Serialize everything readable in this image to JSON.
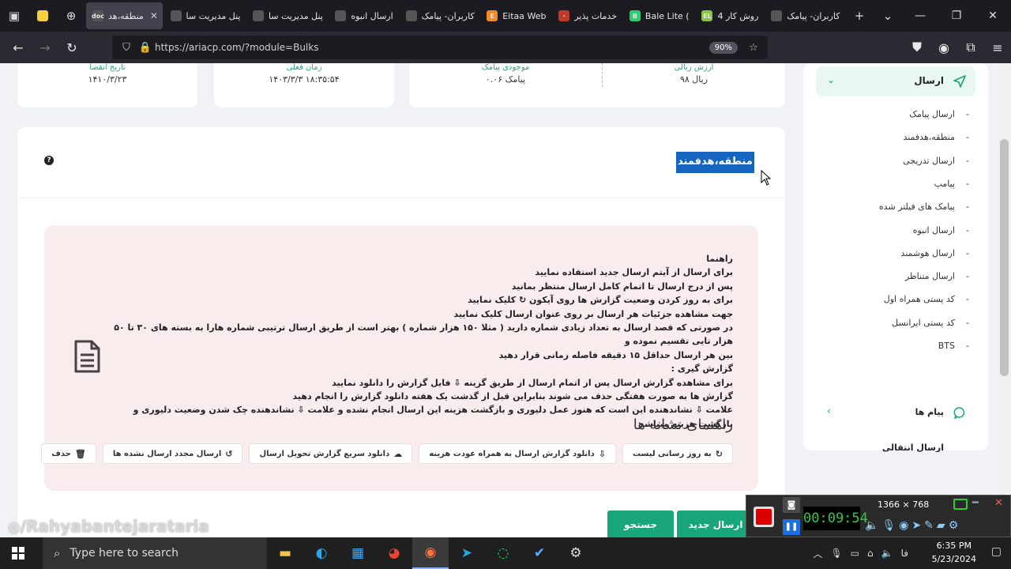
{
  "browser": {
    "tabs": [
      {
        "label": "منطقه،هد",
        "active": true,
        "favicon": "doc",
        "color": "#555"
      },
      {
        "label": "پنل مدیریت سا",
        "active": false,
        "favicon": "",
        "color": "#555"
      },
      {
        "label": "پنل مدیریت سا",
        "active": false,
        "favicon": "",
        "color": "#555"
      },
      {
        "label": "ارسال انبوه",
        "active": false,
        "favicon": "",
        "color": "#555"
      },
      {
        "label": "کاربران- پیامک",
        "active": false,
        "favicon": "",
        "color": "#555"
      },
      {
        "label": "Eitaa Web",
        "active": false,
        "favicon": "E",
        "color": "#f28c28"
      },
      {
        "label": "خدمات پذیر",
        "active": false,
        "favicon": "·",
        "color": "#c0392b"
      },
      {
        "label": "Bale Lite (",
        "active": false,
        "favicon": "B",
        "color": "#2ecc71"
      },
      {
        "label": "4 روش کار",
        "active": false,
        "favicon": "EL",
        "color": "#8bc34a"
      },
      {
        "label": "کاربران- پیامک",
        "active": false,
        "favicon": "",
        "color": "#555"
      }
    ],
    "url": "https://ariacp.com/?module=Bulks",
    "zoom": "90%"
  },
  "stats": [
    {
      "label": "ارزش ریالی",
      "value": "۹۸ ریال"
    },
    {
      "label": "موجودی پیامک",
      "value": "۰.۰۶ پیامک"
    },
    {
      "label": "زمان فعلی",
      "value": "۱۴۰۳/۳/۳ ۱۸:۳۵:۵۴"
    },
    {
      "label": "تاریخ انقضا",
      "value": "۱۴۱۰/۳/۲۳"
    }
  ],
  "page": {
    "title": "منطقه،هدفمند",
    "help": "?"
  },
  "guide": {
    "lines": [
      "راهنما",
      "برای ارسال از آیتم ارسال جدید استفاده نمایید",
      "پس از درج ارسال تا اتمام کامل ارسال منتظر بمانید",
      "برای به روز کردن وضعیت گزارش ها روی آیکون ↻ کلیک نمایید",
      "جهت مشاهده جزئیات هر ارسال بر روی عنوان ارسال کلیک نمایید",
      "در صورتی که قصد ارسال به تعداد زیادی شماره دارید ( مثلا ۱۵۰ هزار شماره ) بهتر است از طریق ارسال ترتیبی شماره هارا به بسته های ۳۰ تا ۵۰ هزار تایی تقسیم نموده و",
      "بین هر ارسال حداقل ۱۵ دقیقه فاصله زمانی قرار دهید",
      "گزارش گیری :",
      "برای مشاهده گزارش ارسال پس از اتمام ارسال از طریق گزینه ⇩ فایل گزارش را دانلود نمایید",
      "گزارش ها به صورت هفتگی حذف می شوند بنابراین قبل از گذشت یک هفته دانلود گزارش را انجام دهید",
      "علامت ⇩ نشاندهنده این است که هنوز عمل دلیوری و بازگشت هزینه این ارسال انجام نشده و علامت ⇩ نشاندهنده چک شدن وضعیت دلیوری و بازگشت هزینه میباشد"
    ],
    "legend_title": "راهنمای نشانه ها",
    "legend": [
      {
        "icon": "↻",
        "label": "به روز رسانی لیست"
      },
      {
        "icon": "⇩",
        "label": "دانلود گزارش ارسال به همراه عودت هزینه"
      },
      {
        "icon": "☁",
        "label": "دانلود سریع گزارش تحویل ارسال"
      },
      {
        "icon": "↺",
        "label": "ارسال مجدد ارسال نشده ها"
      },
      {
        "icon": "🗑",
        "label": "حذف"
      }
    ]
  },
  "actions": {
    "new_send": "ارسال جدید",
    "search": "جستجو"
  },
  "sidebar": {
    "section": "ارسال",
    "items": [
      "ارسال پیامک",
      "منطقه،هدفمند",
      "ارسال تدریجی",
      "پیامپ",
      "پیامک های فیلتر شده",
      "ارسال انبوه",
      "ارسال هوشمند",
      "ارسال متناظر",
      "کد پستی همراه اول",
      "کد پستی ایرانسل",
      "BTS"
    ],
    "messages": "پیام ها",
    "next_partial": "ارسال انتقالی"
  },
  "overlay": {
    "watermark": "/Rahyabantejarataria",
    "resolution": "1366 × 768",
    "timer": "00:09:54"
  },
  "taskbar": {
    "search_placeholder": "Type here to search",
    "time": "6:35 PM",
    "date": "5/23/2024",
    "lang": "فا"
  }
}
